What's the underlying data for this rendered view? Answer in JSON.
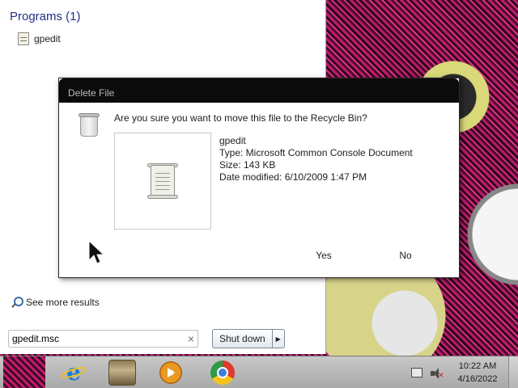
{
  "start_menu": {
    "programs_header": "Programs (1)",
    "program_items": [
      {
        "label": "gpedit",
        "icon": "document-icon"
      }
    ],
    "see_more": "See more results",
    "search_value": "gpedit.msc",
    "clear_symbol": "×",
    "shutdown_label": "Shut down",
    "shutdown_arrow": "▶"
  },
  "dialog": {
    "title": "Delete File",
    "question": "Are you sure you want to move this file to the Recycle Bin?",
    "file": {
      "name": "gpedit",
      "type": "Type: Microsoft Common Console Document",
      "size": "Size: 143 KB",
      "modified": "Date modified: 6/10/2009 1:47 PM"
    },
    "yes_label": "Yes",
    "no_label": "No"
  },
  "taskbar": {
    "pinned": [
      "internet-explorer-icon",
      "windows-explorer-icon",
      "media-player-icon",
      "chrome-icon"
    ],
    "tray": {
      "time": "10:22 AM",
      "date": "4/16/2022",
      "volume": "muted"
    }
  },
  "colors": {
    "dialog_title_bg": "#0b0b0b",
    "programs_header": "#1e3287",
    "wallpaper_accent": "#c01a6e"
  }
}
